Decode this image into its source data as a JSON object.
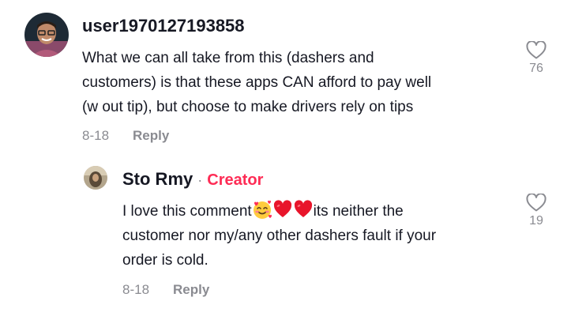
{
  "comments": [
    {
      "username": "user1970127193858",
      "text_lines": [
        "What we can all take from this (dashers and",
        "customers) is that these apps CAN afford to pay well",
        "(w out tip), but choose to make drivers rely on tips"
      ],
      "date": "8-18",
      "reply_label": "Reply",
      "likes": "76"
    }
  ],
  "reply": {
    "username": "Sto Rmy",
    "separator": "·",
    "badge": "Creator",
    "text_before_emoji": "I love this comment",
    "emojis": [
      "smiling-face-with-hearts",
      "red-heart",
      "red-heart"
    ],
    "text_after_emoji": "its neither the",
    "text_lines": [
      "customer nor my/any other dashers fault if your",
      "order is cold."
    ],
    "date": "8-18",
    "reply_label": "Reply",
    "likes": "19"
  },
  "colors": {
    "text": "#161823",
    "muted": "#8a8b91",
    "creator": "#fe2c55"
  }
}
